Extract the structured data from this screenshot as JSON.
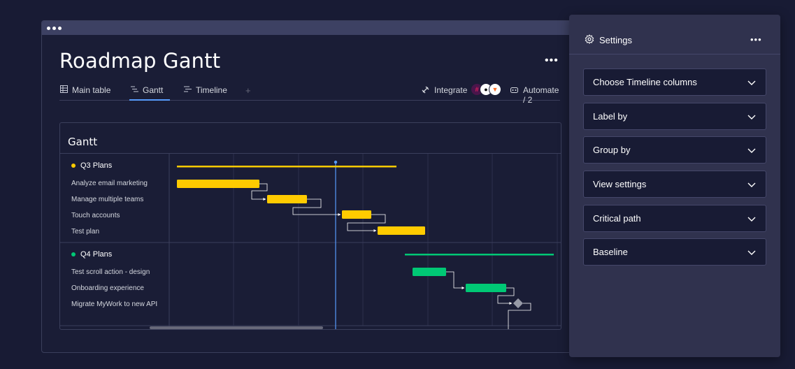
{
  "window": {
    "title": "Roadmap Gantt",
    "more_label": "•••"
  },
  "tabs": [
    {
      "label": "Main table",
      "icon": "table-icon"
    },
    {
      "label": "Gantt",
      "icon": "gantt-icon"
    },
    {
      "label": "Timeline",
      "icon": "timeline-icon"
    }
  ],
  "tab_add": "+",
  "integrate": {
    "label": "Integrate"
  },
  "automate": {
    "label": "Automate / 2"
  },
  "gantt": {
    "title": "Gantt",
    "groups": [
      {
        "name": "Q3 Plans",
        "color": "#ffcb00",
        "items": [
          "Analyze email marketing",
          "Manage multiple teams",
          "Touch accounts",
          "Test plan"
        ]
      },
      {
        "name": "Q4 Plans",
        "color": "#00c875",
        "items": [
          "Test scroll action - design",
          "Onboarding experience",
          "Migrate MyWork to new API"
        ]
      }
    ],
    "today_color": "#579bfc"
  },
  "settings": {
    "title": "Settings",
    "more_label": "•••",
    "sections": [
      "Choose Timeline columns",
      "Label by",
      "Group by",
      "View settings",
      "Critical path",
      "Baseline"
    ]
  }
}
